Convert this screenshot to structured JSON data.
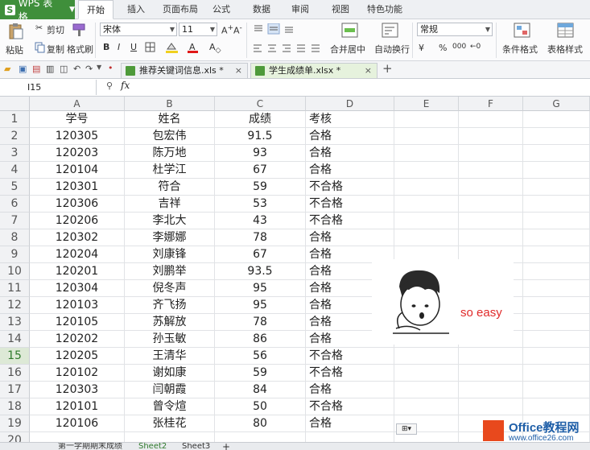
{
  "menubar": {
    "app_name": "WPS 表格",
    "tabs": [
      "开始",
      "插入",
      "页面布局",
      "公式",
      "数据",
      "审阅",
      "视图",
      "特色功能"
    ]
  },
  "ribbon": {
    "paste": "粘贴",
    "cut": "剪切",
    "copy": "复制",
    "format_painter": "格式刷",
    "font_name": "宋体",
    "font_size": "11",
    "bold": "B",
    "italic": "I",
    "underline": "U",
    "merge_center": "合并居中",
    "wrap_text": "自动换行",
    "number_format": "常规",
    "percent": "%",
    "comma": "000",
    "cond_format": "条件格式",
    "table_style": "表格样式"
  },
  "doc_tabs": [
    {
      "name": "推荐关键词信息.xls *",
      "active": false
    },
    {
      "name": "学生成绩单.xlsx *",
      "active": true
    }
  ],
  "formula_bar": {
    "cell_ref": "I15",
    "fx": "fx",
    "value": ""
  },
  "columns": [
    "A",
    "B",
    "C",
    "D",
    "E",
    "F",
    "G"
  ],
  "selected_row": 15,
  "rows": [
    {
      "n": 1,
      "a": "学号",
      "b": "姓名",
      "c": "成绩",
      "d": "考核"
    },
    {
      "n": 2,
      "a": "120305",
      "b": "包宏伟",
      "c": "91.5",
      "d": "合格"
    },
    {
      "n": 3,
      "a": "120203",
      "b": "陈万地",
      "c": "93",
      "d": "合格"
    },
    {
      "n": 4,
      "a": "120104",
      "b": "杜学江",
      "c": "67",
      "d": "合格"
    },
    {
      "n": 5,
      "a": "120301",
      "b": "符合",
      "c": "59",
      "d": "不合格"
    },
    {
      "n": 6,
      "a": "120306",
      "b": "吉祥",
      "c": "53",
      "d": "不合格"
    },
    {
      "n": 7,
      "a": "120206",
      "b": "李北大",
      "c": "43",
      "d": "不合格"
    },
    {
      "n": 8,
      "a": "120302",
      "b": "李娜娜",
      "c": "78",
      "d": "合格"
    },
    {
      "n": 9,
      "a": "120204",
      "b": "刘康锋",
      "c": "67",
      "d": "合格"
    },
    {
      "n": 10,
      "a": "120201",
      "b": "刘鹏举",
      "c": "93.5",
      "d": "合格"
    },
    {
      "n": 11,
      "a": "120304",
      "b": "倪冬声",
      "c": "95",
      "d": "合格"
    },
    {
      "n": 12,
      "a": "120103",
      "b": "齐飞扬",
      "c": "95",
      "d": "合格"
    },
    {
      "n": 13,
      "a": "120105",
      "b": "苏解放",
      "c": "78",
      "d": "合格"
    },
    {
      "n": 14,
      "a": "120202",
      "b": "孙玉敏",
      "c": "86",
      "d": "合格"
    },
    {
      "n": 15,
      "a": "120205",
      "b": "王清华",
      "c": "56",
      "d": "不合格"
    },
    {
      "n": 16,
      "a": "120102",
      "b": "谢如康",
      "c": "59",
      "d": "不合格"
    },
    {
      "n": 17,
      "a": "120303",
      "b": "闫朝霞",
      "c": "84",
      "d": "合格"
    },
    {
      "n": 18,
      "a": "120101",
      "b": "曾令煊",
      "c": "50",
      "d": "不合格"
    },
    {
      "n": 19,
      "a": "120106",
      "b": "张桂花",
      "c": "80",
      "d": "合格"
    },
    {
      "n": 20,
      "a": "",
      "b": "",
      "c": "",
      "d": ""
    }
  ],
  "sticker_text": "so easy",
  "sheet_tabs": [
    "第一学期期末成绩",
    "Sheet2",
    "Sheet3"
  ],
  "add_sheet": "+",
  "watermark": {
    "line1": "Office教程网",
    "line2": "www.office26.com"
  },
  "colors": {
    "accent": "#3f8f3b",
    "sticker_text": "#e02a2a",
    "watermark": "#1f5fa8"
  }
}
